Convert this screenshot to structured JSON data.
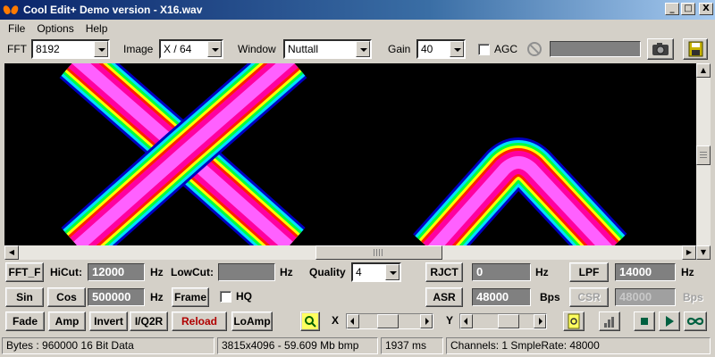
{
  "window": {
    "title": "Cool Edit+  Demo version - X16.wav",
    "min": "_",
    "max": "□",
    "close": "X"
  },
  "menu": [
    "File",
    "Options",
    "Help"
  ],
  "toolbar": {
    "fft_label": "FFT",
    "fft_value": "8192",
    "image_label": "Image",
    "image_value": "X / 64",
    "window_label": "Window",
    "window_value": "Nuttall",
    "gain_label": "Gain",
    "gain_value": "40",
    "agc_label": "AGC"
  },
  "filters": {
    "fft_f_button": "FFT_F",
    "hicut_label": "HiCut:",
    "hicut_value": "12000",
    "hicut_unit": "Hz",
    "lowcut_label": "LowCut:",
    "lowcut_value": "",
    "lowcut_unit": "Hz",
    "quality_label": "Quality",
    "quality_value": "4",
    "rjct_button": "RJCT",
    "rjct_value": "0",
    "rjct_unit": "Hz",
    "lpf_button": "LPF",
    "lpf_value": "14000",
    "lpf_unit": "Hz"
  },
  "generators": {
    "sin_button": "Sin",
    "cos_button": "Cos",
    "freq_value": "500000",
    "freq_unit": "Hz",
    "frame_button": "Frame",
    "hq_label": "HQ",
    "asr_button": "ASR",
    "asr_value": "48000",
    "asr_unit": "Bps",
    "csr_button": "CSR",
    "csr_value": "48000",
    "csr_unit": "Bps"
  },
  "actions": {
    "fade": "Fade",
    "amp": "Amp",
    "invert": "Invert",
    "i_q2r": "I/Q2R",
    "reload": "Reload",
    "loamp": "LoAmp",
    "x_label": "X",
    "y_label": "Y"
  },
  "status": {
    "bytes": "Bytes : 960000 16 Bit Data",
    "image": "3815x4096 - 59.609 Mb bmp",
    "time": "1937 ms",
    "channels": "Channels: 1  SmpleRate: 48000"
  },
  "colors": {
    "titlebar": "#0a246a",
    "reload_text": "#b00000",
    "spectro_bg": "#000000"
  }
}
